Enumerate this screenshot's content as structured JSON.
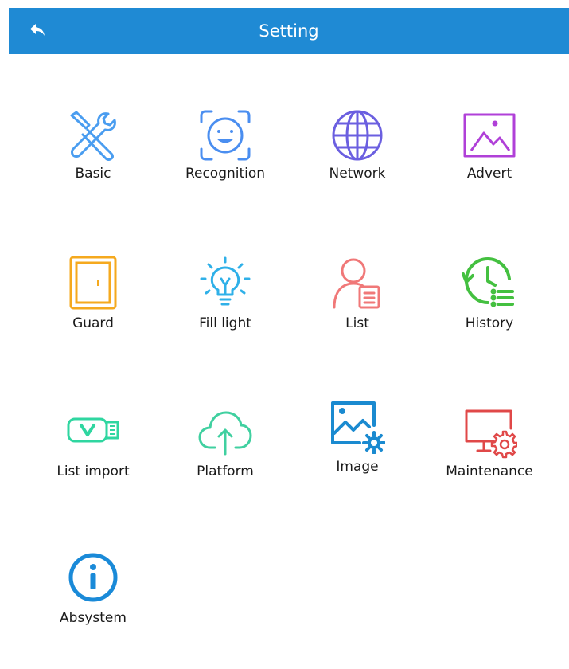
{
  "header": {
    "title": "Setting",
    "back_icon": "back-arrow-icon",
    "color": "#1f8ad4"
  },
  "menu": {
    "items": [
      {
        "label": "Basic",
        "icon": "tools-icon",
        "color": "#4a9df0"
      },
      {
        "label": "Recognition",
        "icon": "face-scan-icon",
        "color": "#4a8ef0"
      },
      {
        "label": "Network",
        "icon": "globe-icon",
        "color": "#6b5fe0"
      },
      {
        "label": "Advert",
        "icon": "picture-icon",
        "color": "#b040d8"
      },
      {
        "label": "Guard",
        "icon": "door-icon",
        "color": "#f5a91e"
      },
      {
        "label": "Fill light",
        "icon": "lightbulb-icon",
        "color": "#2fb0e8"
      },
      {
        "label": "List",
        "icon": "user-list-icon",
        "color": "#f07878"
      },
      {
        "label": "History",
        "icon": "history-clock-icon",
        "color": "#44c040"
      },
      {
        "label": "List import",
        "icon": "usb-drive-icon",
        "color": "#2fd6a0"
      },
      {
        "label": "Platform",
        "icon": "cloud-upload-icon",
        "color": "#40d0a0"
      },
      {
        "label": "Image",
        "icon": "image-settings-icon",
        "color": "#1a8ad0"
      },
      {
        "label": "Maintenance",
        "icon": "monitor-gear-icon",
        "color": "#e04848"
      },
      {
        "label": "Absystem",
        "icon": "info-icon",
        "color": "#1a8ad8"
      }
    ]
  }
}
